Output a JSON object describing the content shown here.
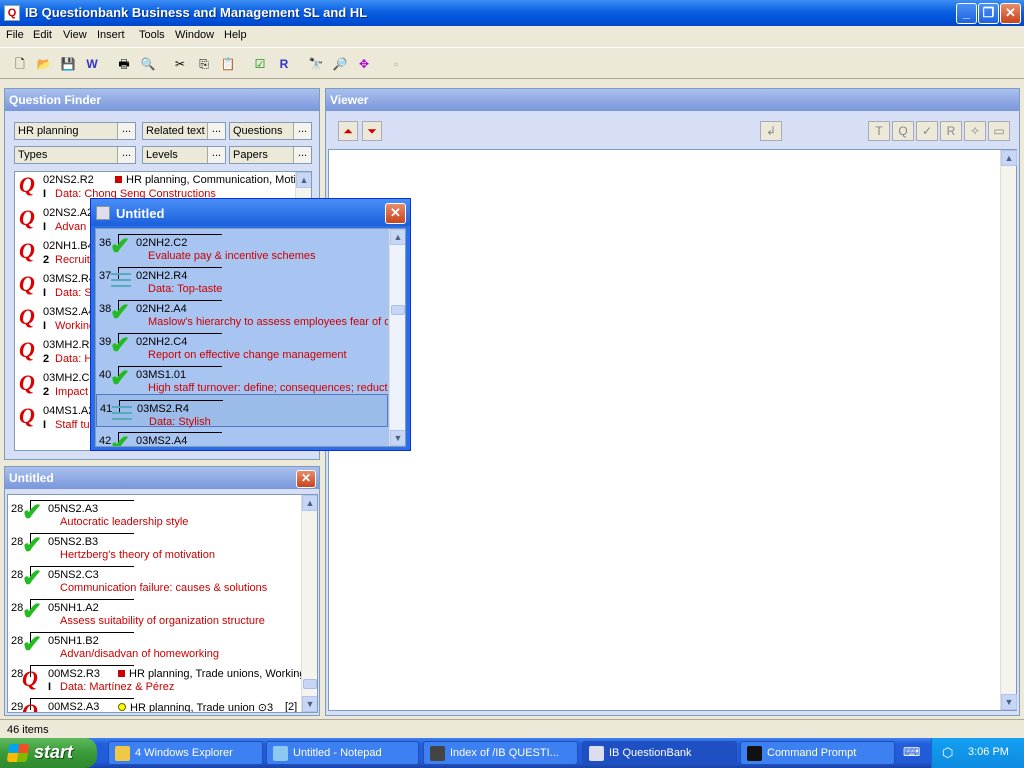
{
  "window": {
    "title": "IB Questionbank Business and Management SL and HL",
    "app_icon_letter": "Q",
    "minimize": "_",
    "maximize": "❐",
    "close": "✕"
  },
  "menu": [
    "File",
    "Edit",
    "View",
    "Insert",
    "Tools",
    "Window",
    "Help"
  ],
  "toolbar": {
    "icons": [
      "new-file-icon",
      "open-folder-icon",
      "save-icon",
      "word-icon",
      "print-icon",
      "print-preview-icon",
      "cut-icon",
      "copy-icon",
      "paste-icon",
      "check-icon",
      "reference-icon",
      "find-icon",
      "zoom-icon",
      "navigate-icon",
      "disabled-icon"
    ],
    "glyphs": [
      "🗋",
      "📂",
      "💾",
      "W",
      "🖶",
      "🔍",
      "✂",
      "⎘",
      "📋",
      "☑",
      "R",
      "🔭",
      "🔎",
      "✥",
      "▫"
    ]
  },
  "finder": {
    "title": "Question Finder",
    "filters": [
      "HR planning",
      "Related text",
      "Questions",
      "Types",
      "Levels",
      "Papers"
    ],
    "button_label": "...",
    "rows": [
      {
        "code": "02NS2.R2",
        "level": "I",
        "desc": "Data: Chong Seng Constructions",
        "topics": "HR planning, Communication, Motivati"
      },
      {
        "code": "02NS2.A2",
        "level": "I",
        "desc": "Advan",
        "topics": ""
      },
      {
        "code": "02NH1.B4",
        "level": "2",
        "desc": "Recruit",
        "topics": ""
      },
      {
        "code": "03MS2.R4",
        "level": "I",
        "desc": "Data: S",
        "topics": ""
      },
      {
        "code": "03MS2.A4",
        "level": "I",
        "desc": "Working",
        "topics": ""
      },
      {
        "code": "03MH2.R5",
        "level": "2",
        "desc": "Data: H",
        "topics": ""
      },
      {
        "code": "03MH2.C5",
        "level": "2",
        "desc": "Impact",
        "topics": ""
      },
      {
        "code": "04MS1.A2",
        "level": "I",
        "desc": "Staff tu",
        "topics": ""
      }
    ]
  },
  "untitled_panel": {
    "title": "Untitled",
    "rows": [
      {
        "num": "28",
        "kind": "check",
        "code": "05NS2.A3",
        "desc": "Autocratic leadership style"
      },
      {
        "num": "28",
        "kind": "check",
        "code": "05NS2.B3",
        "desc": "Hertzberg's theory of motivation"
      },
      {
        "num": "28",
        "kind": "check",
        "code": "05NS2.C3",
        "desc": "Communication failure: causes & solutions"
      },
      {
        "num": "28",
        "kind": "check",
        "code": "05NH1.A2",
        "desc": "Assess suitability of organization structure"
      },
      {
        "num": "28",
        "kind": "check",
        "code": "05NH1.B2",
        "desc": "Advan/disadvan of homeworking"
      },
      {
        "num": "28",
        "kind": "q",
        "code": "00MS2.R3",
        "level": "I",
        "desc": "Data: Martínez & Pérez",
        "topics": "HR planning, Trade unions, Working c"
      },
      {
        "num": "29",
        "kind": "q",
        "code": "00MS2.A3",
        "level": "",
        "desc": "",
        "topics": "HR planning, Trade union ⊙3",
        "extra": "[2]"
      }
    ]
  },
  "dialog": {
    "title": "Untitled",
    "rows": [
      {
        "num": "36",
        "kind": "check",
        "code": "02NH2.C2",
        "desc": "Evaluate pay & incentive schemes"
      },
      {
        "num": "37",
        "kind": "lines",
        "code": "02NH2.R4",
        "desc": "Data: Top-taste"
      },
      {
        "num": "38",
        "kind": "check",
        "code": "02NH2.A4",
        "desc": "Maslow's hierarchy to assess employees fear of cha"
      },
      {
        "num": "39",
        "kind": "check",
        "code": "02NH2.C4",
        "desc": "Report on effective change management"
      },
      {
        "num": "40",
        "kind": "check",
        "code": "03MS1.01",
        "desc": "High staff turnover: define; consequences; reductio"
      },
      {
        "num": "41",
        "kind": "lines",
        "code": "03MS2.R4",
        "desc": "Data: Stylish"
      },
      {
        "num": "42",
        "kind": "check",
        "code": "03MS2.A4",
        "desc": ""
      }
    ]
  },
  "viewer": {
    "title": "Viewer",
    "nav_up": "⏶",
    "nav_down": "⏷",
    "tools": [
      "↲",
      "T",
      "Q",
      "✓",
      "R",
      "✧",
      "▭"
    ]
  },
  "status": {
    "items": "46 items"
  },
  "taskbar": {
    "start": "start",
    "tasks": [
      {
        "label": "4 Windows Explorer",
        "color": "#f0c848",
        "active": false
      },
      {
        "label": "Untitled - Notepad",
        "color": "#8cc8f0",
        "active": false
      },
      {
        "label": "Index of /IB QUESTI...",
        "color": "#444",
        "active": false
      },
      {
        "label": "IB QuestionBank",
        "color": "#dde",
        "active": true
      },
      {
        "label": "Command Prompt",
        "color": "#111",
        "active": false
      }
    ],
    "clock": "3:06 PM"
  }
}
